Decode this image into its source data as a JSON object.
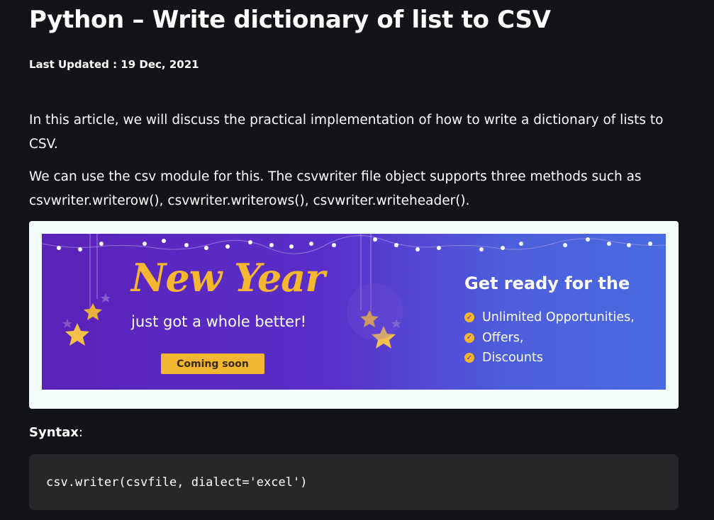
{
  "article": {
    "title": "Python – Write dictionary of list to CSV",
    "last_updated": "Last Updated : 19 Dec, 2021",
    "paragraph1": "In this article, we will discuss the practical implementation of how to write a dictionary of lists to CSV.",
    "paragraph2": "We can use the csv module for this. The csvwriter file object supports three methods such as csvwriter.writerow(), csvwriter.writerows(), csvwriter.writeheader().",
    "syntax_label": "Syntax",
    "syntax_colon": ":",
    "code": "csv.writer(csvfile, dialect='excel')"
  },
  "banner": {
    "headline": "New Year",
    "subline": "just got a whole better!",
    "button": "Coming soon",
    "ready_title": "Get ready for the",
    "items": [
      "Unlimited Opportunities,",
      "Offers,",
      "Discounts"
    ],
    "colors": {
      "accent": "#f2b630",
      "bg_left": "#5a22b8",
      "bg_right": "#4a6ae0"
    }
  }
}
